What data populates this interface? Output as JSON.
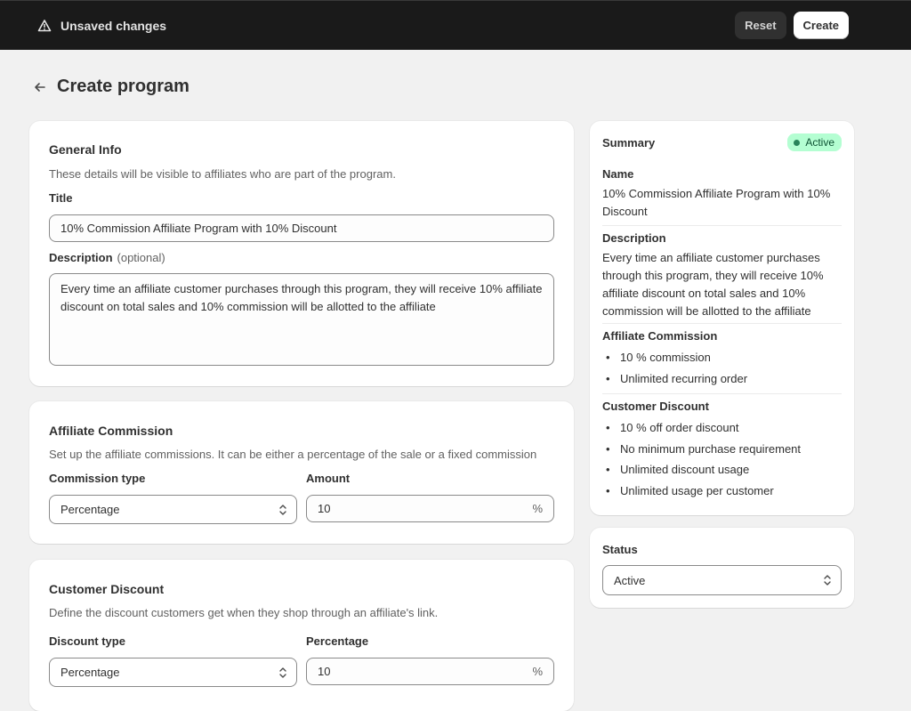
{
  "topbar": {
    "status_text": "Unsaved changes",
    "status_icon": "warning-triangle-icon",
    "reset_label": "Reset",
    "create_label": "Create"
  },
  "page": {
    "back_icon": "arrow-left-icon",
    "title": "Create program"
  },
  "general_info": {
    "title": "General Info",
    "subtitle": "These details will be visible to affiliates who are part of the program.",
    "title_label": "Title",
    "title_value": "10% Commission Affiliate Program with 10% Discount",
    "description_label": "Description",
    "description_optional": "(optional)",
    "description_value": "Every time an affiliate customer purchases through this program, they will receive 10% affiliate discount on total sales and 10% commission will be allotted to the affiliate"
  },
  "affiliate_commission": {
    "title": "Affiliate Commission",
    "subtitle": "Set up the affiliate commissions. It can be either a percentage of the sale or a fixed commission",
    "type_label": "Commission type",
    "type_value": "Percentage",
    "amount_label": "Amount",
    "amount_value": "10",
    "amount_suffix": "%"
  },
  "customer_discount": {
    "title": "Customer Discount",
    "subtitle": "Define the discount customers get when they shop through an affiliate's link.",
    "type_label": "Discount type",
    "type_value": "Percentage",
    "percentage_label": "Percentage",
    "percentage_value": "10",
    "percentage_suffix": "%"
  },
  "summary": {
    "title": "Summary",
    "badge": "Active",
    "badge_color": "#b4fed2",
    "badge_dot_color": "#29845a",
    "name_label": "Name",
    "name_value": "10% Commission Affiliate Program with 10% Discount",
    "description_label": "Description",
    "description_value": "Every time an affiliate customer purchases through this program, they will receive 10% affiliate discount on total sales and 10% commission will be allotted to the affiliate",
    "commission_label": "Affiliate Commission",
    "commission_items": [
      "10 % commission",
      "Unlimited recurring order"
    ],
    "discount_label": "Customer Discount",
    "discount_items": [
      "10 % off order discount",
      "No minimum purchase requirement",
      "Unlimited discount usage",
      "Unlimited usage per customer"
    ]
  },
  "status": {
    "label": "Status",
    "value": "Active"
  }
}
